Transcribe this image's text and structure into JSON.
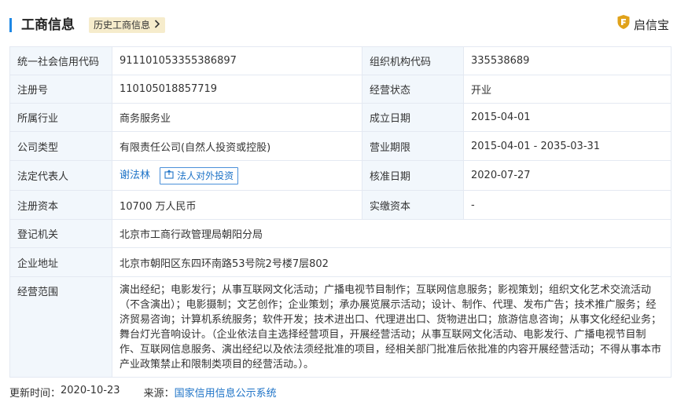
{
  "header": {
    "title": "工商信息",
    "history_label": "历史工商信息",
    "brand": "启信宝"
  },
  "rows": [
    {
      "l1": "统一社会信用代码",
      "v1": "911101053355386897",
      "l2": "组织机构代码",
      "v2": "335538689"
    },
    {
      "l1": "注册号",
      "v1": "110105018857719",
      "l2": "经营状态",
      "v2": "开业"
    },
    {
      "l1": "所属行业",
      "v1": "商务服务业",
      "l2": "成立日期",
      "v2": "2015-04-01"
    },
    {
      "l1": "公司类型",
      "v1": "有限责任公司(自然人投资或控股)",
      "l2": "营业期限",
      "v2": "2015-04-01 - 2035-03-31"
    },
    {
      "l1": "法定代表人",
      "v1": "谢法林",
      "v1_button": "法人对外投资",
      "l2": "核准日期",
      "v2": "2020-07-27"
    },
    {
      "l1": "注册资本",
      "v1": "10700 万人民币",
      "l2": "实缴资本",
      "v2": "-"
    }
  ],
  "wide_rows": [
    {
      "label": "登记机关",
      "value": "北京市工商行政管理局朝阳分局"
    },
    {
      "label": "企业地址",
      "value": "北京市朝阳区东四环南路53号院2号楼7层802"
    },
    {
      "label": "经营范围",
      "value": "演出经纪；电影发行；从事互联网文化活动；广播电视节目制作；互联网信息服务；影视策划；组织文化艺术交流活动（不含演出）；电影摄制；文艺创作；企业策划；承办展览展示活动；设计、制作、代理、发布广告；技术推广服务；经济贸易咨询；计算机系统服务；软件开发；技术进出口、代理进出口、货物进出口；旅游信息咨询；从事文化经纪业务；舞台灯光音响设计。（企业依法自主选择经营项目，开展经营活动；从事互联网文化活动、电影发行、广播电视节目制作、互联网信息服务、演出经纪以及依法须经批准的项目，经相关部门批准后依批准的内容开展经营活动；不得从事本市产业政策禁止和限制类项目的经营活动。）。"
    }
  ],
  "footer": {
    "update_label": "更新时间：",
    "update_value": "2020-10-23",
    "source_label": "来源：",
    "source_value": "国家信用信息公示系统"
  },
  "colors": {
    "accent": "#1e88e5",
    "label_bg": "#f2f7fc",
    "border": "#e4e9f2",
    "history_bg": "#f6eccc",
    "brand_gold": "#e0a21a"
  },
  "icons": {
    "brand": "shield-logo-icon",
    "history": "chevron-right-icon",
    "invest": "export-icon"
  }
}
